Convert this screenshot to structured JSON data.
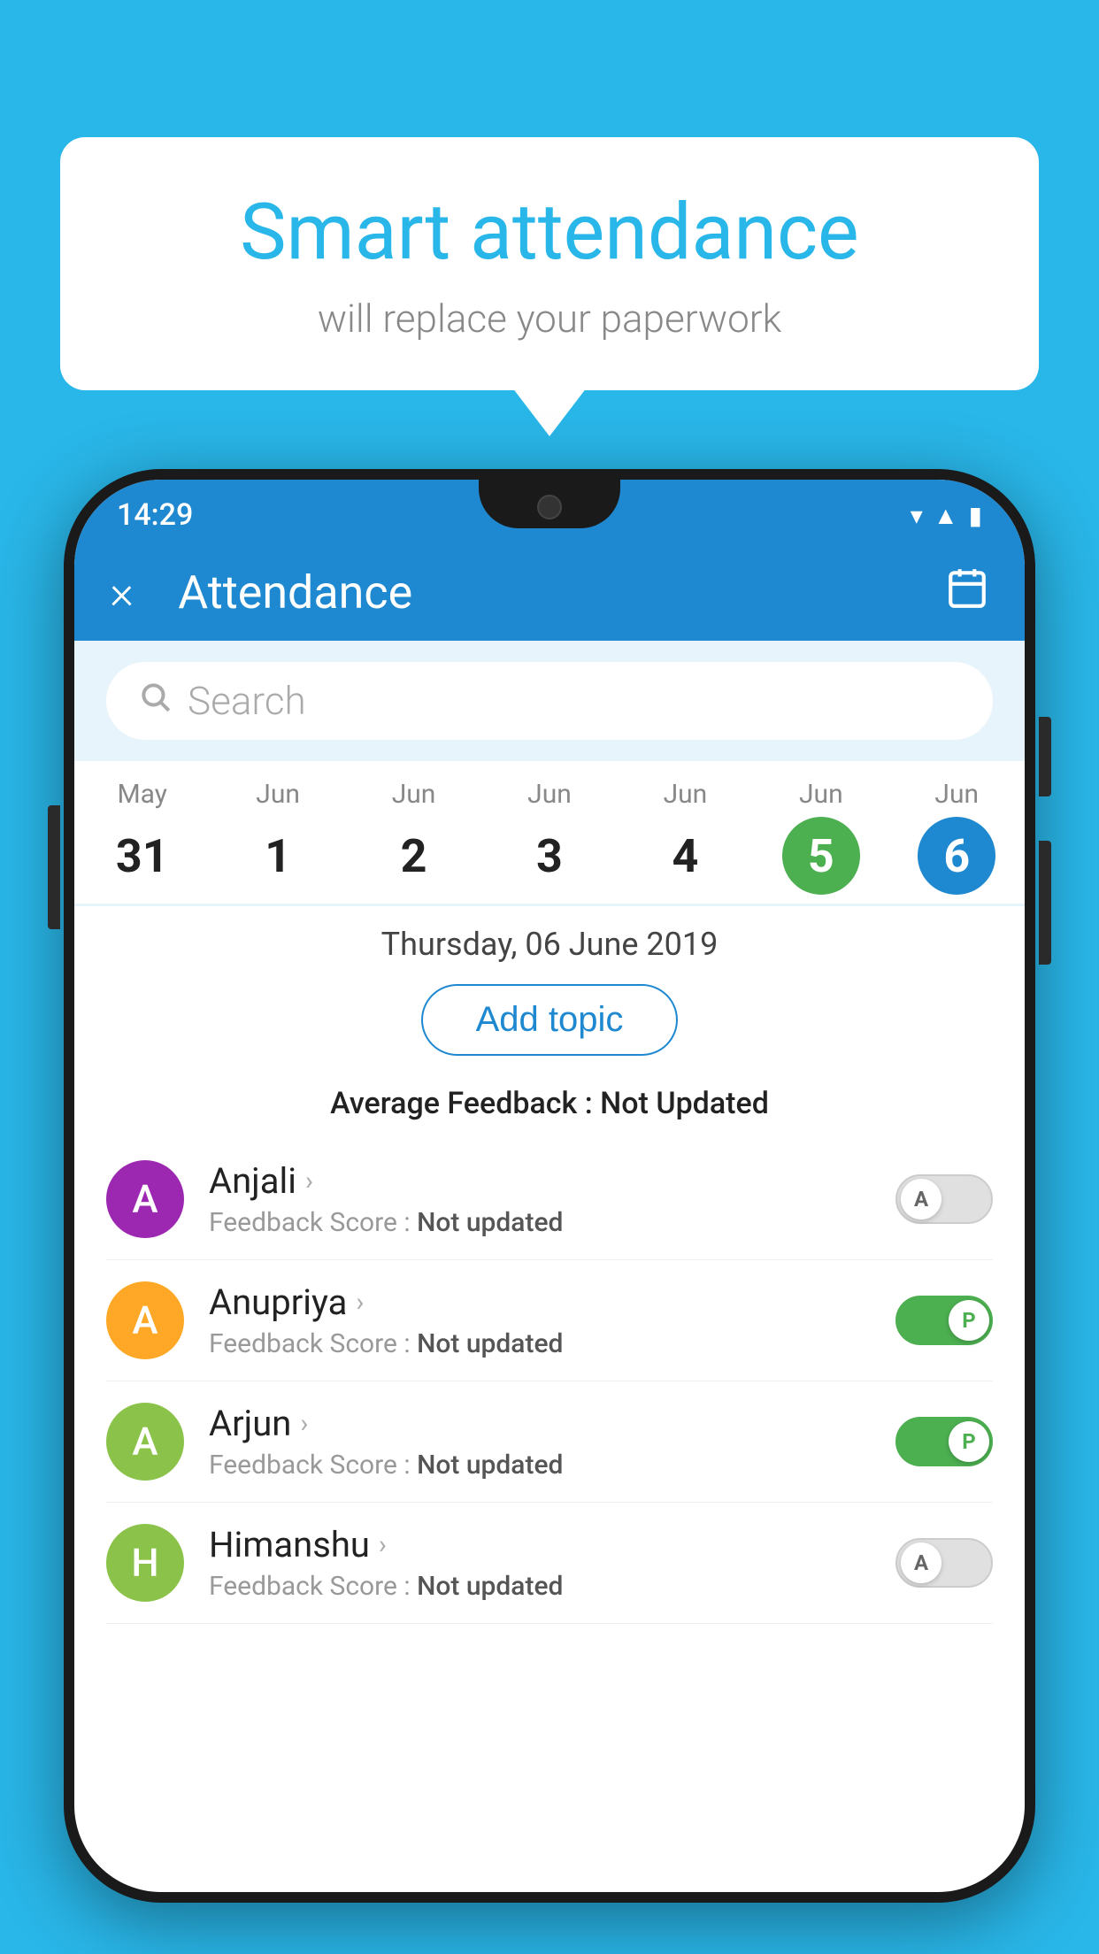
{
  "background_color": "#29b6e8",
  "bubble": {
    "title": "Smart attendance",
    "subtitle": "will replace your paperwork"
  },
  "status_bar": {
    "time": "14:29",
    "icons": [
      "wifi",
      "signal",
      "battery"
    ]
  },
  "header": {
    "title": "Attendance",
    "close_label": "×",
    "calendar_icon": "📅"
  },
  "search": {
    "placeholder": "Search"
  },
  "calendar": {
    "days": [
      {
        "month": "May",
        "num": "31",
        "state": "normal"
      },
      {
        "month": "Jun",
        "num": "1",
        "state": "normal"
      },
      {
        "month": "Jun",
        "num": "2",
        "state": "normal"
      },
      {
        "month": "Jun",
        "num": "3",
        "state": "normal"
      },
      {
        "month": "Jun",
        "num": "4",
        "state": "normal"
      },
      {
        "month": "Jun",
        "num": "5",
        "state": "today"
      },
      {
        "month": "Jun",
        "num": "6",
        "state": "selected"
      }
    ]
  },
  "selected_date": "Thursday, 06 June 2019",
  "add_topic_label": "Add topic",
  "avg_feedback_label": "Average Feedback :",
  "avg_feedback_value": "Not Updated",
  "students": [
    {
      "name": "Anjali",
      "avatar_letter": "A",
      "avatar_color": "#9c27b0",
      "feedback_label": "Feedback Score :",
      "feedback_value": "Not updated",
      "toggle": "off",
      "toggle_letter": "A"
    },
    {
      "name": "Anupriya",
      "avatar_letter": "A",
      "avatar_color": "#ffa726",
      "feedback_label": "Feedback Score :",
      "feedback_value": "Not updated",
      "toggle": "on",
      "toggle_letter": "P"
    },
    {
      "name": "Arjun",
      "avatar_letter": "A",
      "avatar_color": "#8bc34a",
      "feedback_label": "Feedback Score :",
      "feedback_value": "Not updated",
      "toggle": "on",
      "toggle_letter": "P"
    },
    {
      "name": "Himanshu",
      "avatar_letter": "H",
      "avatar_color": "#8bc34a",
      "feedback_label": "Feedback Score :",
      "feedback_value": "Not updated",
      "toggle": "off",
      "toggle_letter": "A"
    }
  ]
}
